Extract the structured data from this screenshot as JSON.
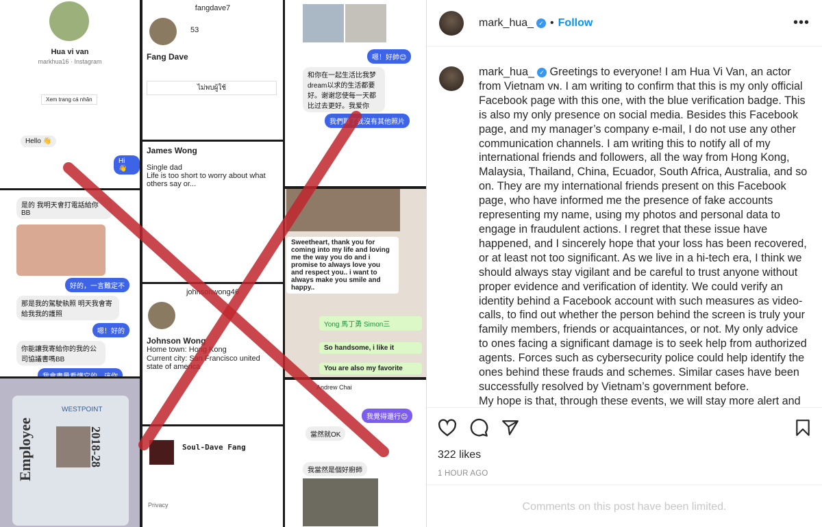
{
  "media": {
    "panels": {
      "p1_name": "Hua vi van",
      "p1_sub": "markhua16 · Instagram",
      "p1_btn": "Xem trang cá nhân",
      "p1_hello": "Hello 👋",
      "p1_hi": "Hi 👋",
      "p2_user": "fangdave7",
      "p2_count": "53",
      "p2_name": "Fang Dave",
      "p2_btn": "ไม่พบผู้ใช้",
      "p3_name": "James Wong",
      "p3_bio": "Single dad",
      "p3_bio2": "Life is too short to worry about what others say or...",
      "p4_user": "johnsonwong46",
      "p4_name": "Johnson Wong",
      "p4_bio": "Home town: Hong Kong",
      "p4_bio2": "Current city: San Francisco united state of america",
      "p5_name": "Soul-Dave Fang",
      "p5_privacy": "Privacy",
      "p6_msg1": "嗯！好帥😊",
      "p6_msg2": "和你在一起生活比我梦dream以求的生活都要好。谢谢您使每一天都比过去更好。我爱你",
      "p6_msg3": "我們聊了我沒有其他照片",
      "p7_msg": "Sweetheart, thank you for coming into my life and loving me the way you do and i promise to always love you and respect you.. i want to always make you smile and happy..",
      "p7_quote": "Yong 馬丁勇 Simon三",
      "p7_reply": "So handsome, i like it",
      "p7_reply2": "You are also my favorite",
      "p8_name": "Andrew Chai",
      "p8_msg1": "我覺得還行😊",
      "p8_msg2": "當然就OK",
      "p8_msg3": "我當然是個好廚師",
      "p9_msg1": "是的 我明天會打電話給你BB",
      "p9_msg2": "好的，一言難定不",
      "p9_msg3": "那是我的駕駛執照 明天我會寄給我我的護照",
      "p9_msg4": "嗯！好的",
      "p9_msg5": "你能讓我寄給你的我的公司協議書嗎BB",
      "p9_msg6": "我會盡量看懂它的，這你",
      "p10_card": "Employee",
      "p10_year": "2018-28",
      "p10_brand": "WESTPOINT"
    },
    "overlay_color": "#c0272d"
  },
  "header": {
    "username": "mark_hua_",
    "verified": true,
    "separator": "•",
    "follow_label": "Follow",
    "more_icon": "more-horizontal-icon"
  },
  "caption": {
    "username": "mark_hua_",
    "text": "Greetings to everyone! I am Hua Vi Van, an actor from Vietnam ᴠɴ. I am writing to confirm that this is my only official Facebook page with this one, with the blue verification badge. This is also my only presence on social media. Besides this Facebook page, and my manager’s company e-mail, I do not use any other communication channels. I am writing this to notify all of my international friends and followers, all the way from Hong Kong, Malaysia, Thailand, China, Ecuador, South Africa, Australia, and so on. They are my international friends present on this Facebook page, who have informed me the presence of fake accounts representing my name, using my photos and personal data to engage in fraudulent actions. I regret that these issue have happened, and I sincerely hope that your loss has been recovered, or at least not too significant. As we live in a hi-tech era, I think we should always stay vigilant and be careful to trust anyone without proper evidence and verification of identity. We could verify an identity behind a Facebook account with such measures as video-calls, to find out whether the person behind the screen is truly your family members, friends or acquaintances, or not. My only advice to ones facing a significant damage is to seek help from authorized agents. Forces such as cybersecurity police could help identify the ones behind these frauds and schemes. Similar cases have been successfully resolved by Vietnam’s government before.",
    "text2": "My hope is that, through these events, we will stay more alert and"
  },
  "actions": {
    "icons": [
      "heart-icon",
      "comment-icon",
      "share-icon",
      "bookmark-icon"
    ]
  },
  "likes": "322 likes",
  "time": "1 HOUR AGO",
  "comments_notice": "Comments on this post have been limited.",
  "colors": {
    "accent": "#0095f6",
    "verified": "#3897f0"
  }
}
